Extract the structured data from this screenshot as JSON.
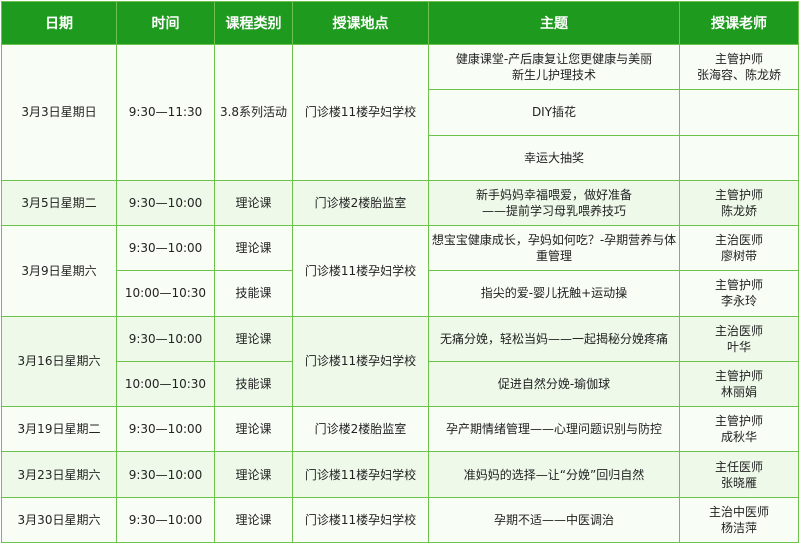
{
  "headers": {
    "date": "日期",
    "time": "时间",
    "category": "课程类别",
    "location": "授课地点",
    "topic": "主题",
    "teacher": "授课老师"
  },
  "rows": [
    {
      "date": "3月3日星期日",
      "time": "9:30—11:30",
      "category": "3.8系列活动",
      "location": "门诊楼11楼孕妇学校",
      "topics": [
        {
          "line1": "健康课堂-产后康复让您更健康与美丽",
          "line2": "新生儿护理技术",
          "teacher_title": "主管护师",
          "teacher_name": "张海容、陈龙娇"
        },
        {
          "line1": "DIY插花",
          "line2": "",
          "teacher_title": "",
          "teacher_name": ""
        },
        {
          "line1": "幸运大抽奖",
          "line2": "",
          "teacher_title": "",
          "teacher_name": ""
        }
      ]
    },
    {
      "date": "3月5日星期二",
      "time": "9:30—10:00",
      "category": "理论课",
      "location": "门诊楼2楼胎监室",
      "topic_line1": "新手妈妈幸福喂爱，做好准备",
      "topic_line2": "——提前学习母乳喂养技巧",
      "teacher_title": "主管护师",
      "teacher_name": "陈龙娇"
    },
    {
      "date": "3月9日星期六",
      "location": "门诊楼11楼孕妇学校",
      "sessions": [
        {
          "time": "9:30—10:00",
          "category": "理论课",
          "topic_line1": "想宝宝健康成长，孕妈如何吃？-孕期营养与体",
          "topic_line2": "重管理",
          "teacher_title": "主治医师",
          "teacher_name": "廖树带"
        },
        {
          "time": "10:00—10:30",
          "category": "技能课",
          "topic_line1": "指尖的爱-婴儿抚触+运动操",
          "topic_line2": "",
          "teacher_title": "主管护师",
          "teacher_name": "李永玲"
        }
      ]
    },
    {
      "date": "3月16日星期六",
      "location": "门诊楼11楼孕妇学校",
      "sessions": [
        {
          "time": "9:30—10:00",
          "category": "理论课",
          "topic_line1": "无痛分娩，轻松当妈——一起揭秘分娩疼痛",
          "topic_line2": "",
          "teacher_title": "主治医师",
          "teacher_name": "叶华"
        },
        {
          "time": "10:00—10:30",
          "category": "技能课",
          "topic_line1": "促进自然分娩-瑜伽球",
          "topic_line2": "",
          "teacher_title": "主管护师",
          "teacher_name": "林丽娟"
        }
      ]
    },
    {
      "date": "3月19日星期二",
      "time": "9:30—10:00",
      "category": "理论课",
      "location": "门诊楼2楼胎监室",
      "topic_line1": "孕产期情绪管理——心理问题识别与防控",
      "teacher_title": "主管护师",
      "teacher_name": "成秋华"
    },
    {
      "date": "3月23日星期六",
      "time": "9:30—10:00",
      "category": "理论课",
      "location": "门诊楼11楼孕妇学校",
      "topic_line1": "准妈妈的选择—让“分娩”回归自然",
      "teacher_title": "主任医师",
      "teacher_name": "张晓雁"
    },
    {
      "date": "3月30日星期六",
      "time": "9:30—10:00",
      "category": "理论课",
      "location": "门诊楼11楼孕妇学校",
      "topic_line1": "孕期不适——中医调治",
      "teacher_title": "主治中医师",
      "teacher_name": "杨洁萍"
    }
  ]
}
